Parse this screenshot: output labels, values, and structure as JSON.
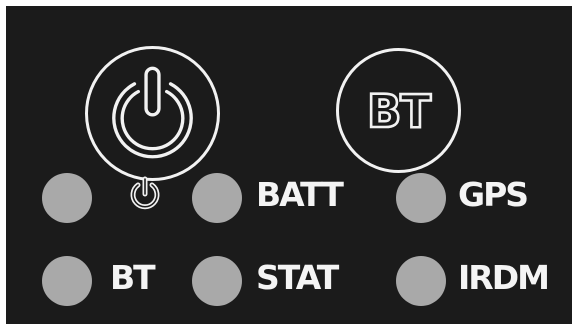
{
  "panel": {
    "power_button": {
      "icon": "power-icon"
    },
    "bt_button": {
      "label": "BT"
    }
  },
  "indicators": {
    "row1": [
      {
        "icon": "power-icon",
        "label": "",
        "led_color": "#a9a9a9"
      },
      {
        "label": "BATT",
        "led_color": "#a9a9a9"
      },
      {
        "label": "GPS",
        "led_color": "#a9a9a9"
      }
    ],
    "row2": [
      {
        "label": "BT",
        "led_color": "#a9a9a9"
      },
      {
        "label": "STAT",
        "led_color": "#a9a9a9"
      },
      {
        "label": "IRDM",
        "led_color": "#a9a9a9"
      }
    ]
  },
  "colors": {
    "panel_bg": "#1b1b1b",
    "foreground": "#f2f2f2",
    "led_off": "#a9a9a9"
  }
}
